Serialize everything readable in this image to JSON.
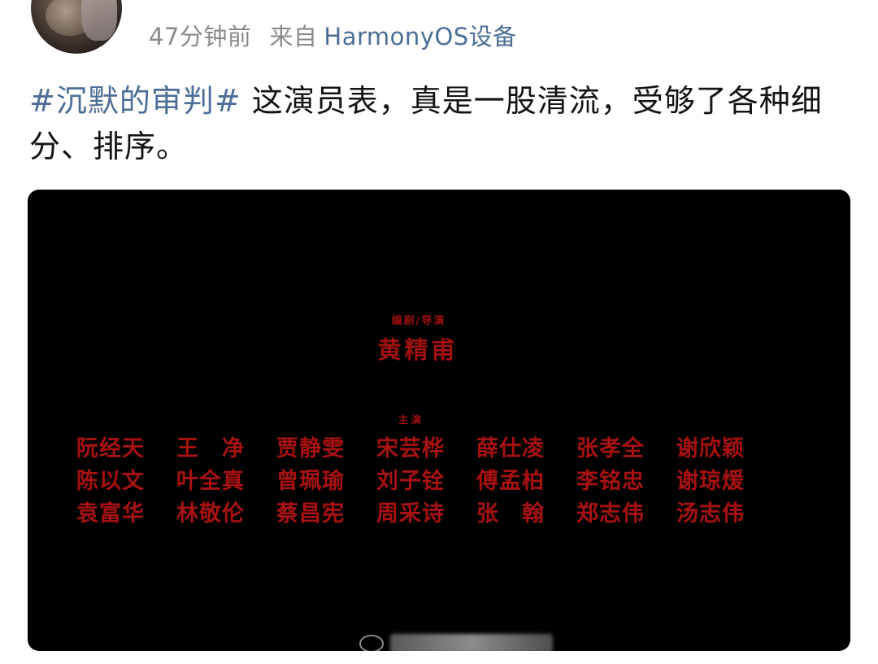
{
  "post": {
    "user_name": "",
    "time_ago": "47分钟前",
    "source_prefix": "来自",
    "source_device": "HarmonyOS设备",
    "hashtag": "#沉默的审判#",
    "body": " 这演员表，真是一股清流，受够了各种细分、排序。"
  },
  "credits": {
    "director_role": "编剧/导演",
    "director_name": "黄精甫",
    "cast_role": "主演",
    "cast": [
      "阮经天",
      "王　净",
      "贾静雯",
      "宋芸桦",
      "薛仕凌",
      "张孝全",
      "谢欣颖",
      "陈以文",
      "叶全真",
      "曾珮瑜",
      "刘子铨",
      "傅孟柏",
      "李铭忠",
      "谢琼煖",
      "袁富华",
      "林敬伦",
      "蔡昌宪",
      "周采诗",
      "张　翰",
      "郑志伟",
      "汤志伟"
    ]
  },
  "colors": {
    "hashtag": "#4d6e96",
    "credit_red": "#b51313",
    "media_bg": "#000000",
    "meta_gray": "#8a8a8a"
  },
  "icons": {
    "avatar": "user-avatar",
    "watermark_logo": "weibo-logo-icon"
  }
}
